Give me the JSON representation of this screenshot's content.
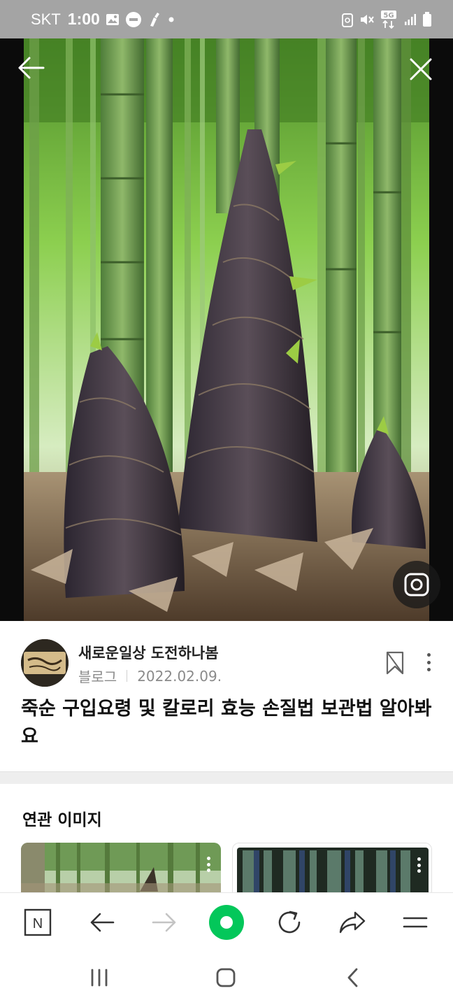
{
  "status_bar": {
    "carrier": "SKT",
    "time": "1:00",
    "network": "5G",
    "left_icons": [
      "image-icon",
      "oil-lock-icon",
      "cleaning-icon",
      "notification-dot-icon"
    ],
    "right_icons": [
      "recycle-icon",
      "mute-icon",
      "5g-data-icon",
      "signal-icon",
      "battery-icon"
    ]
  },
  "viewer": {
    "back_icon": "back-arrow-icon",
    "close_icon": "close-icon",
    "lens_icon": "camera-lens-icon"
  },
  "post": {
    "author": "새로운일상 도전하나봄",
    "source": "블로그",
    "date": "2022.02.09.",
    "title": "죽순 구입요령 및 칼로리 효능 손질법 보관법 알아봐요"
  },
  "related": {
    "title": "연관 이미지"
  },
  "toolbar": {
    "home_logo": "N",
    "items": [
      "home-n-icon",
      "back-icon",
      "forward-icon",
      "green-dot-button",
      "refresh-icon",
      "share-icon",
      "menu-icon"
    ]
  },
  "navbar": {
    "items": [
      "recent-apps-icon",
      "home-icon",
      "back-icon"
    ]
  },
  "colors": {
    "status_bar": "#a4a4a4",
    "accent_green": "#03c75a",
    "divider": "#eeeeee"
  }
}
